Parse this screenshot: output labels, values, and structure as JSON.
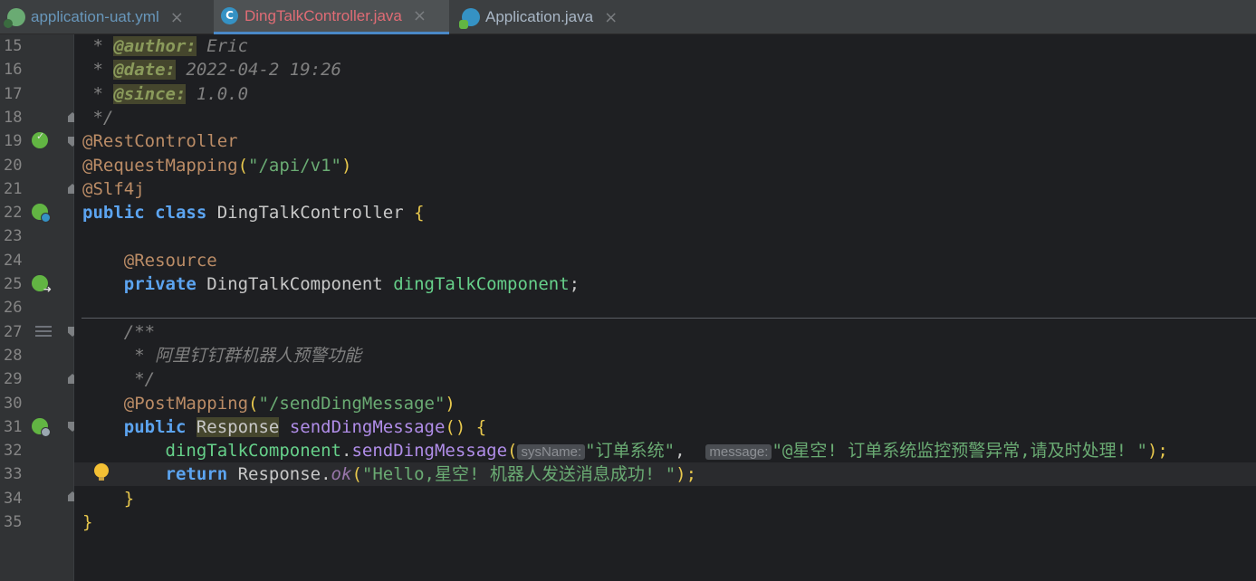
{
  "tabs": [
    {
      "label": "application-uat.yml",
      "icon": "yaml-file-icon",
      "active": false,
      "color": "#6897bb"
    },
    {
      "label": "DingTalkController.java",
      "icon": "java-class-icon",
      "active": true,
      "color": "#e06c75"
    },
    {
      "label": "Application.java",
      "icon": "spring-app-icon",
      "active": false,
      "color": "#a9b7c6"
    }
  ],
  "close_glyph": "×",
  "editor": {
    "line_numbers": [
      "15",
      "16",
      "17",
      "18",
      "19",
      "20",
      "21",
      "22",
      "23",
      "24",
      "25",
      "26",
      "27",
      "28",
      "29",
      "30",
      "31",
      "32",
      "33",
      "34",
      "35"
    ],
    "lines": [
      {
        "tokens": [
          {
            "t": " * ",
            "c": "comment"
          },
          {
            "t": "@author:",
            "c": "tag"
          },
          {
            "t": " Eric",
            "c": "comment"
          }
        ]
      },
      {
        "tokens": [
          {
            "t": " * ",
            "c": "comment"
          },
          {
            "t": "@date:",
            "c": "tag"
          },
          {
            "t": " 2022-04-2 19:26",
            "c": "comment"
          }
        ]
      },
      {
        "tokens": [
          {
            "t": " * ",
            "c": "comment"
          },
          {
            "t": "@since:",
            "c": "tag"
          },
          {
            "t": " 1.0.0",
            "c": "comment"
          }
        ]
      },
      {
        "tokens": [
          {
            "t": " */",
            "c": "comment"
          }
        ]
      },
      {
        "tokens": [
          {
            "t": "@RestController",
            "c": "anno"
          }
        ]
      },
      {
        "tokens": [
          {
            "t": "@RequestMapping",
            "c": "anno"
          },
          {
            "t": "(",
            "c": "brace"
          },
          {
            "t": "\"/api/v1\"",
            "c": "str"
          },
          {
            "t": ")",
            "c": "brace"
          }
        ]
      },
      {
        "tokens": [
          {
            "t": "@Slf4j",
            "c": "anno"
          }
        ]
      },
      {
        "tokens": [
          {
            "t": "public",
            "c": "kw"
          },
          {
            "t": " ",
            "c": "plain"
          },
          {
            "t": "class",
            "c": "kw"
          },
          {
            "t": " DingTalkController ",
            "c": "plain"
          },
          {
            "t": "{",
            "c": "brace"
          }
        ]
      },
      {
        "tokens": []
      },
      {
        "tokens": [
          {
            "t": "    ",
            "c": "plain"
          },
          {
            "t": "@Resource",
            "c": "anno"
          }
        ]
      },
      {
        "tokens": [
          {
            "t": "    ",
            "c": "plain"
          },
          {
            "t": "private",
            "c": "kw"
          },
          {
            "t": " DingTalkComponent ",
            "c": "plain"
          },
          {
            "t": "dingTalkComponent",
            "c": "field"
          },
          {
            "t": ";",
            "c": "plain"
          }
        ]
      },
      {
        "tokens": []
      },
      {
        "tokens": [
          {
            "t": "    /**",
            "c": "comment"
          }
        ]
      },
      {
        "tokens": [
          {
            "t": "     * 阿里钉钉群机器人预警功能",
            "c": "comment"
          }
        ]
      },
      {
        "tokens": [
          {
            "t": "     */",
            "c": "comment"
          }
        ]
      },
      {
        "tokens": [
          {
            "t": "    ",
            "c": "plain"
          },
          {
            "t": "@PostMapping",
            "c": "anno"
          },
          {
            "t": "(",
            "c": "brace"
          },
          {
            "t": "\"/sendDingMessage\"",
            "c": "str"
          },
          {
            "t": ")",
            "c": "brace"
          }
        ]
      },
      {
        "tokens": [
          {
            "t": "    ",
            "c": "plain"
          },
          {
            "t": "public",
            "c": "kw"
          },
          {
            "t": " ",
            "c": "plain"
          },
          {
            "t": "Response",
            "c": "hl-type"
          },
          {
            "t": " ",
            "c": "plain"
          },
          {
            "t": "sendDingMessage",
            "c": "method"
          },
          {
            "t": "() ",
            "c": "brace"
          },
          {
            "t": "{",
            "c": "brace"
          }
        ]
      },
      {
        "tokens": [
          {
            "t": "        ",
            "c": "plain"
          },
          {
            "t": "dingTalkComponent",
            "c": "field"
          },
          {
            "t": ".",
            "c": "plain"
          },
          {
            "t": "sendDingMessage",
            "c": "method"
          },
          {
            "t": "(",
            "c": "brace"
          },
          {
            "t": "sysName:",
            "c": "hint"
          },
          {
            "t": "\"订单系统\"",
            "c": "str"
          },
          {
            "t": ",  ",
            "c": "plain"
          },
          {
            "t": "message:",
            "c": "hint"
          },
          {
            "t": "\"@星空! 订单系统监控预警异常,请及时处理! \"",
            "c": "str"
          },
          {
            "t": ");",
            "c": "brace"
          }
        ]
      },
      {
        "tokens": [
          {
            "t": "        ",
            "c": "plain"
          },
          {
            "t": "return",
            "c": "kw"
          },
          {
            "t": " Response.",
            "c": "plain"
          },
          {
            "t": "ok",
            "c": "static"
          },
          {
            "t": "(",
            "c": "brace"
          },
          {
            "t": "\"Hello,星空! 机器人发送消息成功! \"",
            "c": "str"
          },
          {
            "t": ");",
            "c": "brace"
          }
        ]
      },
      {
        "tokens": [
          {
            "t": "    ",
            "c": "plain"
          },
          {
            "t": "}",
            "c": "brace"
          }
        ]
      },
      {
        "tokens": [
          {
            "t": "}",
            "c": "brace"
          }
        ]
      }
    ]
  }
}
